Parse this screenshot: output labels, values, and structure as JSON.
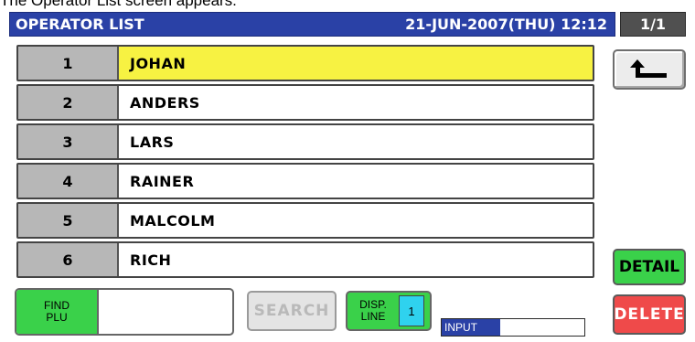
{
  "caption": "The Operator List screen appears.",
  "header": {
    "title": "OPERATOR LIST",
    "datetime": "21-JUN-2007(THU) 12:12",
    "page": "1/1"
  },
  "operators": [
    {
      "num": "1",
      "name": "JOHAN"
    },
    {
      "num": "2",
      "name": "ANDERS"
    },
    {
      "num": "3",
      "name": "LARS"
    },
    {
      "num": "4",
      "name": "RAINER"
    },
    {
      "num": "5",
      "name": "MALCOLM"
    },
    {
      "num": "6",
      "name": "RICH"
    }
  ],
  "selected_index": 0,
  "buttons": {
    "back_icon": "back-arrow-icon",
    "detail": "DETAIL",
    "delete": "DELETE",
    "search": "SEARCH"
  },
  "find_plu": {
    "label_line1": "FIND",
    "label_line2": "PLU",
    "value": ""
  },
  "disp_line": {
    "label_line1": "DISP.",
    "label_line2": "LINE",
    "value": "1"
  },
  "input_indicator": {
    "label": "INPUT"
  },
  "colors": {
    "title_bar": "#2a41a6",
    "selected_row": "#f7f242",
    "green_button": "#3ad14a",
    "red_button": "#ef4a4a",
    "disp_value": "#2fd2ee"
  }
}
